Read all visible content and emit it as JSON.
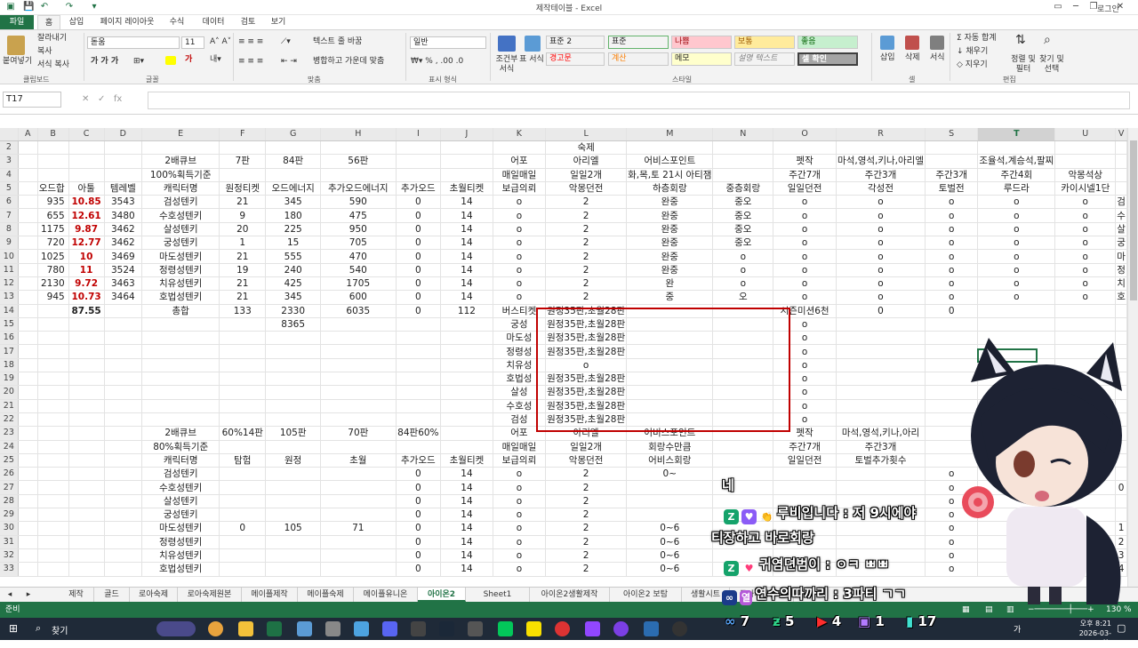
{
  "window": {
    "title": "제작테이블 - Excel",
    "login": "로그인"
  },
  "ribbon_tabs": [
    "파일",
    "홈",
    "삽입",
    "페이지 레이아웃",
    "수식",
    "데이터",
    "검토",
    "보기"
  ],
  "clipboard": {
    "paste": "붙여넣기",
    "cut": "잘라내기",
    "copy": "복사",
    "format_painter": "서식 복사",
    "group": "클립보드"
  },
  "font": {
    "name": "돋움",
    "size": "11",
    "group": "글꼴"
  },
  "alignment": {
    "wrap": "텍스트 줄 바꿈",
    "merge": "병합하고 가운데 맞춤",
    "group": "맞춤"
  },
  "number": {
    "format": "일반",
    "group": "표시 형식"
  },
  "styles": {
    "conditional": "조건부 서식",
    "table": "표 서식",
    "group": "스타일",
    "cells": [
      {
        "label": "표준 2",
        "bg": "#ffffff",
        "fg": "#000000"
      },
      {
        "label": "표준",
        "bg": "#ffffff",
        "fg": "#000000"
      },
      {
        "label": "나쁨",
        "bg": "#ffc7ce",
        "fg": "#9c0006"
      },
      {
        "label": "보통",
        "bg": "#ffeb9c",
        "fg": "#9c5700"
      },
      {
        "label": "좋음",
        "bg": "#c6efce",
        "fg": "#006100"
      },
      {
        "label": "경고문",
        "bg": "#ffffff",
        "fg": "#ff0000"
      },
      {
        "label": "계산",
        "bg": "#f2f2f2",
        "fg": "#fa7d00"
      },
      {
        "label": "메모",
        "bg": "#ffffcc",
        "fg": "#000000"
      },
      {
        "label": "설명 텍스트",
        "bg": "#ffffff",
        "fg": "#7f7f7f"
      },
      {
        "label": "셀 확인",
        "bg": "#a5a5a5",
        "fg": "#ffffff"
      }
    ]
  },
  "cells_group": {
    "insert": "삽입",
    "delete": "삭제",
    "format": "서식",
    "group": "셀"
  },
  "editing": {
    "autosum": "자동 합계",
    "fill": "채우기",
    "clear": "지우기",
    "sort": "정렬 및 필터",
    "find": "찾기 및 선택",
    "group": "편집"
  },
  "formula_bar": {
    "name_box": "T17",
    "fx": "fx",
    "value": ""
  },
  "columns": [
    "A",
    "B",
    "C",
    "D",
    "E",
    "F",
    "G",
    "H",
    "I",
    "J",
    "K",
    "L",
    "M",
    "N",
    "O",
    "R",
    "S",
    "T",
    "U",
    "V"
  ],
  "selected_column": "T",
  "rows": [
    {
      "n": "2",
      "c": [
        "",
        "",
        "",
        "",
        "",
        "",
        "",
        "",
        "",
        "",
        "",
        "숙제",
        "",
        "",
        "",
        "",
        "",
        "",
        "",
        ""
      ]
    },
    {
      "n": "3",
      "c": [
        "",
        "",
        "",
        "",
        "2배큐브",
        "7판",
        "84판",
        "56판",
        "",
        "",
        "어포",
        "아리엘",
        "어비스포인트",
        "",
        "펫작",
        "마석,영석,키나,아리엘",
        "",
        "조율석,계승석,팔찌",
        "",
        ""
      ]
    },
    {
      "n": "4",
      "c": [
        "",
        "",
        "",
        "",
        "100%획득기준",
        "",
        "",
        "",
        "",
        "",
        "매일매일",
        "일일2개",
        "화,목,토 21시 아티잼",
        "",
        "주간7개",
        "주간3개",
        "주간3개",
        "주간4회",
        "악몽석상",
        ""
      ]
    },
    {
      "n": "5",
      "c": [
        "",
        "오드합",
        "아툴",
        "템레벨",
        "캐릭터명",
        "원정티켓",
        "오드에너지",
        "추가오드에너지",
        "추가오드",
        "초월티켓",
        "보급의뢰",
        "악몽던전",
        "하층회랑",
        "중층회랑",
        "일일던전",
        "각성전",
        "토벌전",
        "루드라",
        "카이시넬1단",
        ""
      ]
    },
    {
      "n": "6",
      "c": [
        "",
        "935",
        "10.85",
        "3543",
        "검성텐키",
        "21",
        "345",
        "590",
        "0",
        "14",
        "o",
        "2",
        "완중",
        "중오",
        "o",
        "o",
        "o",
        "o",
        "o",
        "검"
      ]
    },
    {
      "n": "7",
      "c": [
        "",
        "655",
        "12.61",
        "3480",
        "수호성텐키",
        "9",
        "180",
        "475",
        "0",
        "14",
        "o",
        "2",
        "완중",
        "중오",
        "o",
        "o",
        "o",
        "o",
        "o",
        "수"
      ]
    },
    {
      "n": "8",
      "c": [
        "",
        "1175",
        "9.87",
        "3462",
        "살성텐키",
        "20",
        "225",
        "950",
        "0",
        "14",
        "o",
        "2",
        "완중",
        "중오",
        "o",
        "o",
        "o",
        "o",
        "o",
        "살"
      ]
    },
    {
      "n": "9",
      "c": [
        "",
        "720",
        "12.77",
        "3462",
        "궁성텐키",
        "1",
        "15",
        "705",
        "0",
        "14",
        "o",
        "2",
        "완중",
        "중오",
        "o",
        "o",
        "o",
        "o",
        "o",
        "궁"
      ]
    },
    {
      "n": "10",
      "c": [
        "",
        "1025",
        "10",
        "3469",
        "마도성텐키",
        "21",
        "555",
        "470",
        "0",
        "14",
        "o",
        "2",
        "완중",
        "o",
        "o",
        "o",
        "o",
        "o",
        "o",
        "마"
      ]
    },
    {
      "n": "11",
      "c": [
        "",
        "780",
        "11",
        "3524",
        "정령성텐키",
        "19",
        "240",
        "540",
        "0",
        "14",
        "o",
        "2",
        "완중",
        "o",
        "o",
        "o",
        "o",
        "o",
        "o",
        "정"
      ]
    },
    {
      "n": "12",
      "c": [
        "",
        "2130",
        "9.72",
        "3463",
        "치유성텐키",
        "21",
        "425",
        "1705",
        "0",
        "14",
        "o",
        "2",
        "완",
        "o",
        "o",
        "o",
        "o",
        "o",
        "o",
        "치"
      ]
    },
    {
      "n": "13",
      "c": [
        "",
        "945",
        "10.73",
        "3464",
        "호법성텐키",
        "21",
        "345",
        "600",
        "0",
        "14",
        "o",
        "2",
        "중",
        "오",
        "o",
        "o",
        "o",
        "o",
        "o",
        "호"
      ]
    },
    {
      "n": "14",
      "c": [
        "",
        "",
        "87.55",
        "",
        "총합",
        "133",
        "2330",
        "6035",
        "0",
        "112",
        "버스티켓",
        "원정35판,초월28판",
        "",
        "",
        "시즌미션6천",
        "0",
        "0",
        "",
        "",
        ""
      ]
    },
    {
      "n": "15",
      "c": [
        "",
        "",
        "",
        "",
        "",
        "",
        "8365",
        "",
        "",
        "",
        "궁성",
        "원정35판,초월28판",
        "",
        "",
        "o",
        "",
        "",
        "",
        "",
        ""
      ]
    },
    {
      "n": "16",
      "c": [
        "",
        "",
        "",
        "",
        "",
        "",
        "",
        "",
        "",
        "",
        "마도성",
        "원정35판,초월28판",
        "",
        "",
        "o",
        "",
        "",
        "",
        "",
        ""
      ]
    },
    {
      "n": "17",
      "c": [
        "",
        "",
        "",
        "",
        "",
        "",
        "",
        "",
        "",
        "",
        "정령성",
        "원정35판,초월28판",
        "",
        "",
        "o",
        "",
        "",
        "",
        "",
        ""
      ]
    },
    {
      "n": "18",
      "c": [
        "",
        "",
        "",
        "",
        "",
        "",
        "",
        "",
        "",
        "",
        "치유성",
        "o",
        "",
        "",
        "o",
        "",
        "",
        "",
        "",
        ""
      ]
    },
    {
      "n": "19",
      "c": [
        "",
        "",
        "",
        "",
        "",
        "",
        "",
        "",
        "",
        "",
        "호법성",
        "원정35판,초월28판",
        "",
        "",
        "o",
        "",
        "",
        "",
        "",
        ""
      ]
    },
    {
      "n": "20",
      "c": [
        "",
        "",
        "",
        "",
        "",
        "",
        "",
        "",
        "",
        "",
        "살성",
        "원정35판,초월28판",
        "",
        "",
        "o",
        "",
        "",
        "",
        "",
        ""
      ]
    },
    {
      "n": "21",
      "c": [
        "",
        "",
        "",
        "",
        "",
        "",
        "",
        "",
        "",
        "",
        "수호성",
        "원정35판,초월28판",
        "",
        "",
        "o",
        "",
        "",
        "",
        "",
        ""
      ]
    },
    {
      "n": "22",
      "c": [
        "",
        "",
        "",
        "",
        "",
        "",
        "",
        "",
        "",
        "",
        "검성",
        "원정35판,초월28판",
        "",
        "",
        "o",
        "",
        "",
        "",
        "",
        ""
      ]
    },
    {
      "n": "23",
      "c": [
        "",
        "",
        "",
        "",
        "2배큐브",
        "60%14판",
        "105판",
        "70판",
        "84판60%",
        "",
        "어포",
        "아리엘",
        "어비스포인트",
        "",
        "펫작",
        "마석,영석,키나,아리",
        "",
        "",
        "",
        ""
      ]
    },
    {
      "n": "24",
      "c": [
        "",
        "",
        "",
        "",
        "80%획득기준",
        "",
        "",
        "",
        "",
        "",
        "매일매일",
        "일일2개",
        "회랑수만큼",
        "",
        "주간7개",
        "주간3개",
        "",
        "",
        "",
        ""
      ]
    },
    {
      "n": "25",
      "c": [
        "",
        "",
        "",
        "",
        "캐릭터명",
        "탐험",
        "원정",
        "초월",
        "추가오드",
        "초월티켓",
        "보급의뢰",
        "악몽던전",
        "어비스회랑",
        "",
        "일일던전",
        "토벌추가횟수",
        "",
        "",
        "",
        ""
      ]
    },
    {
      "n": "26",
      "c": [
        "",
        "",
        "",
        "",
        "검성텐키",
        "",
        "",
        "",
        "0",
        "14",
        "o",
        "2",
        "0~",
        "",
        "",
        "",
        "o",
        "",
        "",
        ""
      ]
    },
    {
      "n": "27",
      "c": [
        "",
        "",
        "",
        "",
        "수호성텐키",
        "",
        "",
        "",
        "0",
        "14",
        "o",
        "2",
        "",
        "",
        "",
        "",
        "o",
        "",
        "",
        "0"
      ]
    },
    {
      "n": "28",
      "c": [
        "",
        "",
        "",
        "",
        "살성텐키",
        "",
        "",
        "",
        "0",
        "14",
        "o",
        "2",
        "",
        "",
        "",
        "",
        "o",
        "",
        "",
        ""
      ]
    },
    {
      "n": "29",
      "c": [
        "",
        "",
        "",
        "",
        "궁성텐키",
        "",
        "",
        "",
        "0",
        "14",
        "o",
        "2",
        "",
        "",
        "",
        "",
        "o",
        "",
        "",
        ""
      ]
    },
    {
      "n": "30",
      "c": [
        "",
        "",
        "",
        "",
        "마도성텐키",
        "0",
        "105",
        "71",
        "0",
        "14",
        "o",
        "2",
        "0~6",
        "",
        "",
        "",
        "o",
        "",
        "",
        "1"
      ]
    },
    {
      "n": "31",
      "c": [
        "",
        "",
        "",
        "",
        "정령성텐키",
        "",
        "",
        "",
        "0",
        "14",
        "o",
        "2",
        "0~6",
        "",
        "",
        "",
        "o",
        "",
        "",
        "2"
      ]
    },
    {
      "n": "32",
      "c": [
        "",
        "",
        "",
        "",
        "치유성텐키",
        "",
        "",
        "",
        "0",
        "14",
        "o",
        "2",
        "0~6",
        "",
        "",
        "",
        "o",
        "",
        "",
        "3"
      ]
    },
    {
      "n": "33",
      "c": [
        "",
        "",
        "",
        "",
        "호법성텐키",
        "",
        "",
        "",
        "0",
        "14",
        "o",
        "2",
        "0~6",
        "",
        "",
        "",
        "o",
        "",
        "",
        "4"
      ]
    }
  ],
  "sheet_tabs": [
    "제작",
    "골드",
    "로아숙제",
    "로아숙제원본",
    "메이플제작",
    "메이플숙제",
    "메이플유니온",
    "아이온2",
    "Sheet1",
    "아이온2생활제작",
    "아이온2 보탐",
    "생활시트",
    "로아캐릭정리"
  ],
  "active_sheet": "아이온2",
  "status": {
    "mode": "준비",
    "zoom": "130 %"
  },
  "taskbar": {
    "search": "찾기",
    "time": "오후 8:21",
    "date": "2026-03-10(화)",
    "lang": "가"
  },
  "chat": [
    {
      "user": "",
      "text": "네"
    },
    {
      "user": "루비입니다",
      "text": "저 9시에야"
    },
    {
      "user": "",
      "text": "티장하고 바로회랑"
    },
    {
      "user": "귀염뎐범이",
      "text": "ㅇㅋ ㅃㅃ"
    },
    {
      "user": "열",
      "text": "연수의따까리 : 3파티 ㄱㄱ"
    }
  ],
  "counters": [
    "7",
    "5",
    "4",
    "1",
    "17"
  ]
}
